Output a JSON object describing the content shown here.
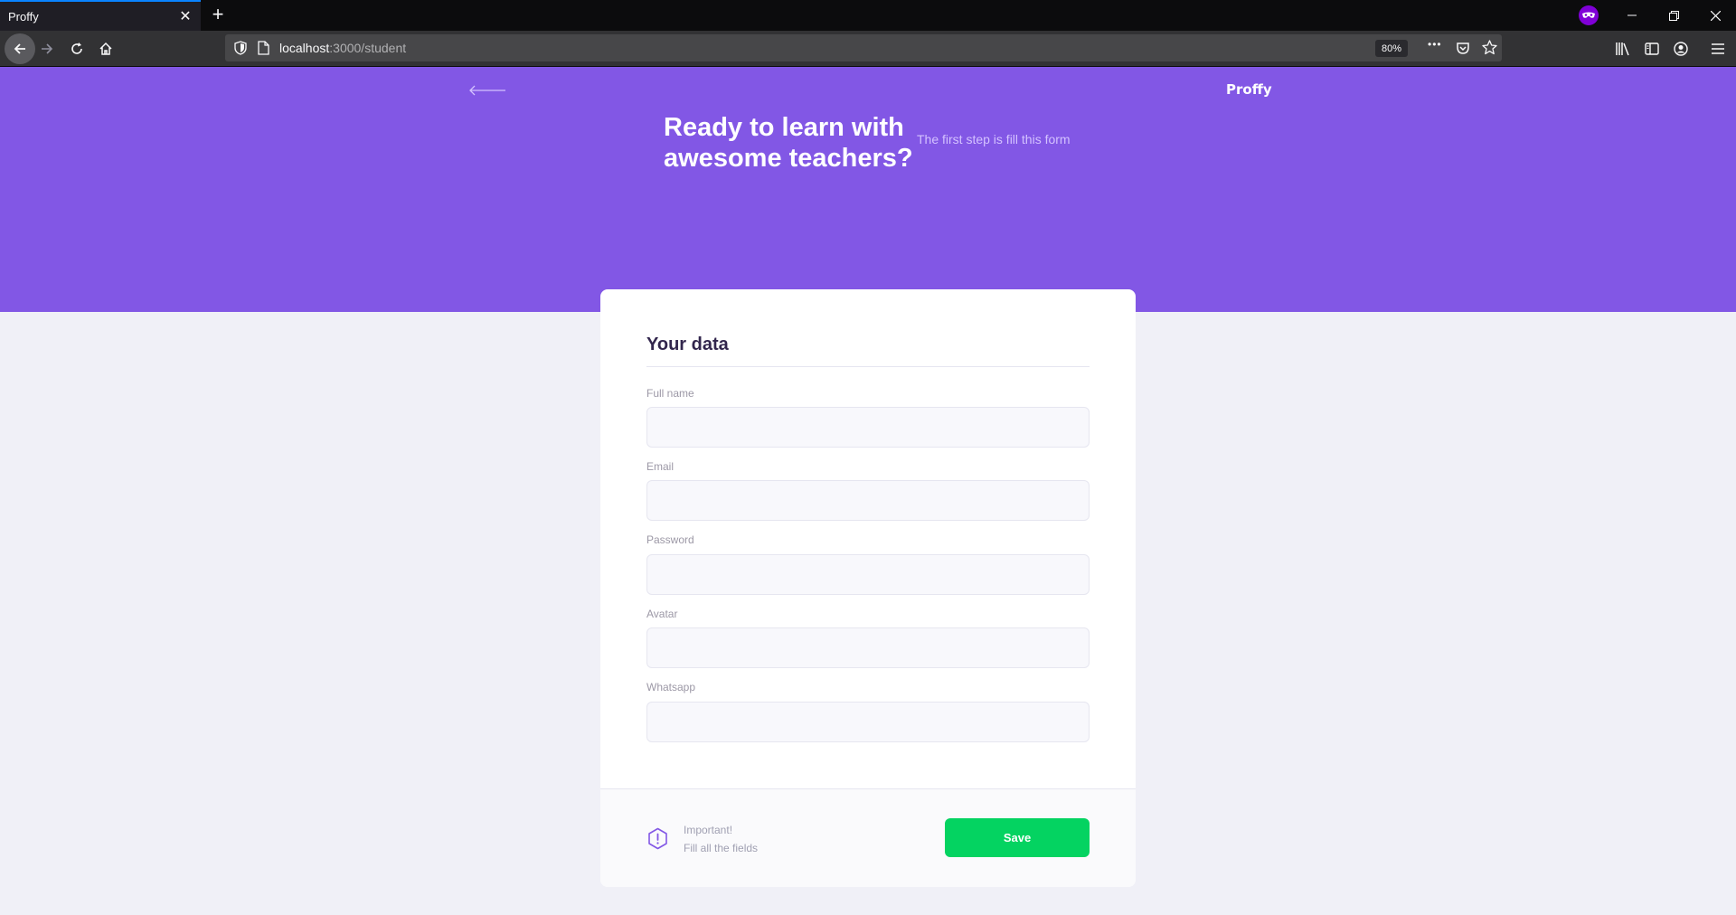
{
  "browser": {
    "tab_title": "Proffy",
    "new_tab_label": "+",
    "url_host": "localhost",
    "url_path": ":3000/student",
    "zoom": "80%",
    "more_label": "•••"
  },
  "header": {
    "brand": "Proffy",
    "title": "Ready to learn with awesome teachers?",
    "subtitle": "The first step is fill this form"
  },
  "form": {
    "legend": "Your data",
    "fields": [
      {
        "label": "Full name",
        "value": ""
      },
      {
        "label": "Email",
        "value": ""
      },
      {
        "label": "Password",
        "value": ""
      },
      {
        "label": "Avatar",
        "value": ""
      },
      {
        "label": "Whatsapp",
        "value": ""
      }
    ]
  },
  "footer": {
    "important": "Important!",
    "note": "Fill all the fields",
    "save_label": "Save"
  },
  "colors": {
    "primary": "#8257e5",
    "secondary": "#04d361",
    "background": "#f0f0f7"
  }
}
